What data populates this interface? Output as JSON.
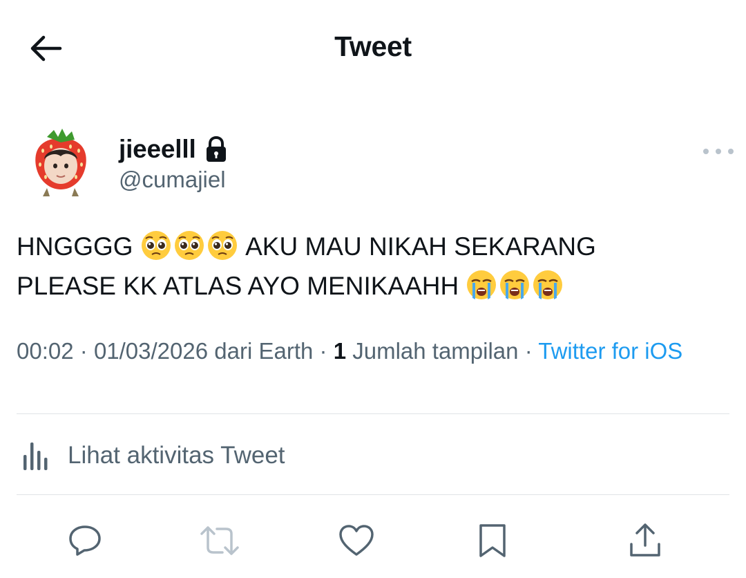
{
  "header": {
    "title": "Tweet"
  },
  "author": {
    "display_name": "jieeelll",
    "handle": "@cumajiel"
  },
  "tweet": {
    "line1_text": "HNGGGG",
    "line1_suffix": "AKU MAU NIKAH SEKARANG",
    "line2_text": "PLEASE KK ATLAS AYO MENIKAAHH"
  },
  "meta": {
    "time": "00:02",
    "date": "01/03/2026",
    "location": "dari Earth",
    "separator": "·",
    "view_count": "1",
    "view_label": "Jumlah tampilan",
    "source": "Twitter for iOS"
  },
  "activity": {
    "label": "Lihat aktivitas Tweet"
  },
  "icons": {
    "back": "arrow-left-icon",
    "lock": "lock-icon",
    "more": "more-horizontal-icon",
    "activity": "bar-chart-icon",
    "reply": "reply-icon",
    "retweet": "retweet-icon",
    "like": "heart-icon",
    "bookmark": "bookmark-icon",
    "share": "share-icon"
  },
  "colors": {
    "text_primary": "#0f1419",
    "text_secondary": "#536471",
    "link": "#1d9bf0",
    "divider": "#dfe3e6"
  }
}
